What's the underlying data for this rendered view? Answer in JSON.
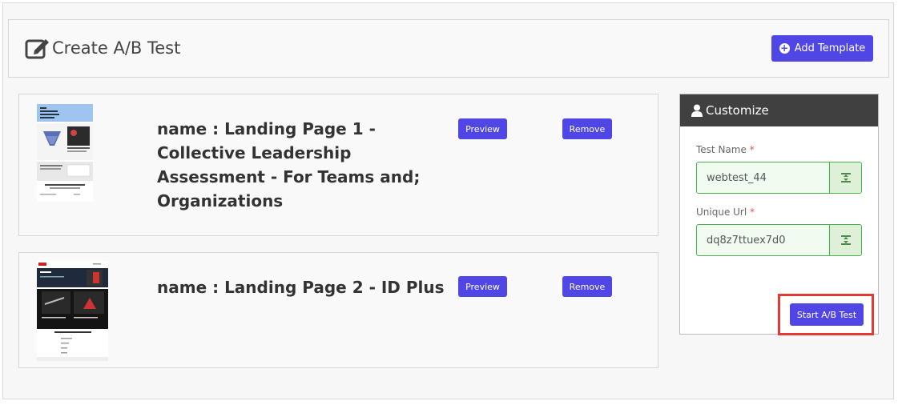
{
  "header": {
    "title": "Create A/B Test",
    "add_template_label": "Add Template"
  },
  "templates": [
    {
      "name": "name : Landing Page 1 - Collective Leadership Assessment - For Teams and; Organizations",
      "preview_label": "Preview",
      "remove_label": "Remove",
      "thumb_title": "Collective Leadership Assessment"
    },
    {
      "name": "name : Landing Page 2 - ID Plus",
      "preview_label": "Preview",
      "remove_label": "Remove",
      "thumb_brand": "BSA",
      "thumb_title": "ID Plus",
      "thumb_subtitle": "Get started with ID Plus"
    }
  ],
  "customize": {
    "title": "Customize",
    "test_name_label": "Test Name",
    "test_name_value": "webtest_44",
    "unique_url_label": "Unique Url",
    "unique_url_value": "dq8z7ttuex7d0",
    "required_mark": "*",
    "start_label": "Start A/B Test"
  },
  "colors": {
    "primary": "#5046e5",
    "header_dark": "#404040",
    "success_border": "#4cae4c",
    "highlight": "#e53935"
  }
}
